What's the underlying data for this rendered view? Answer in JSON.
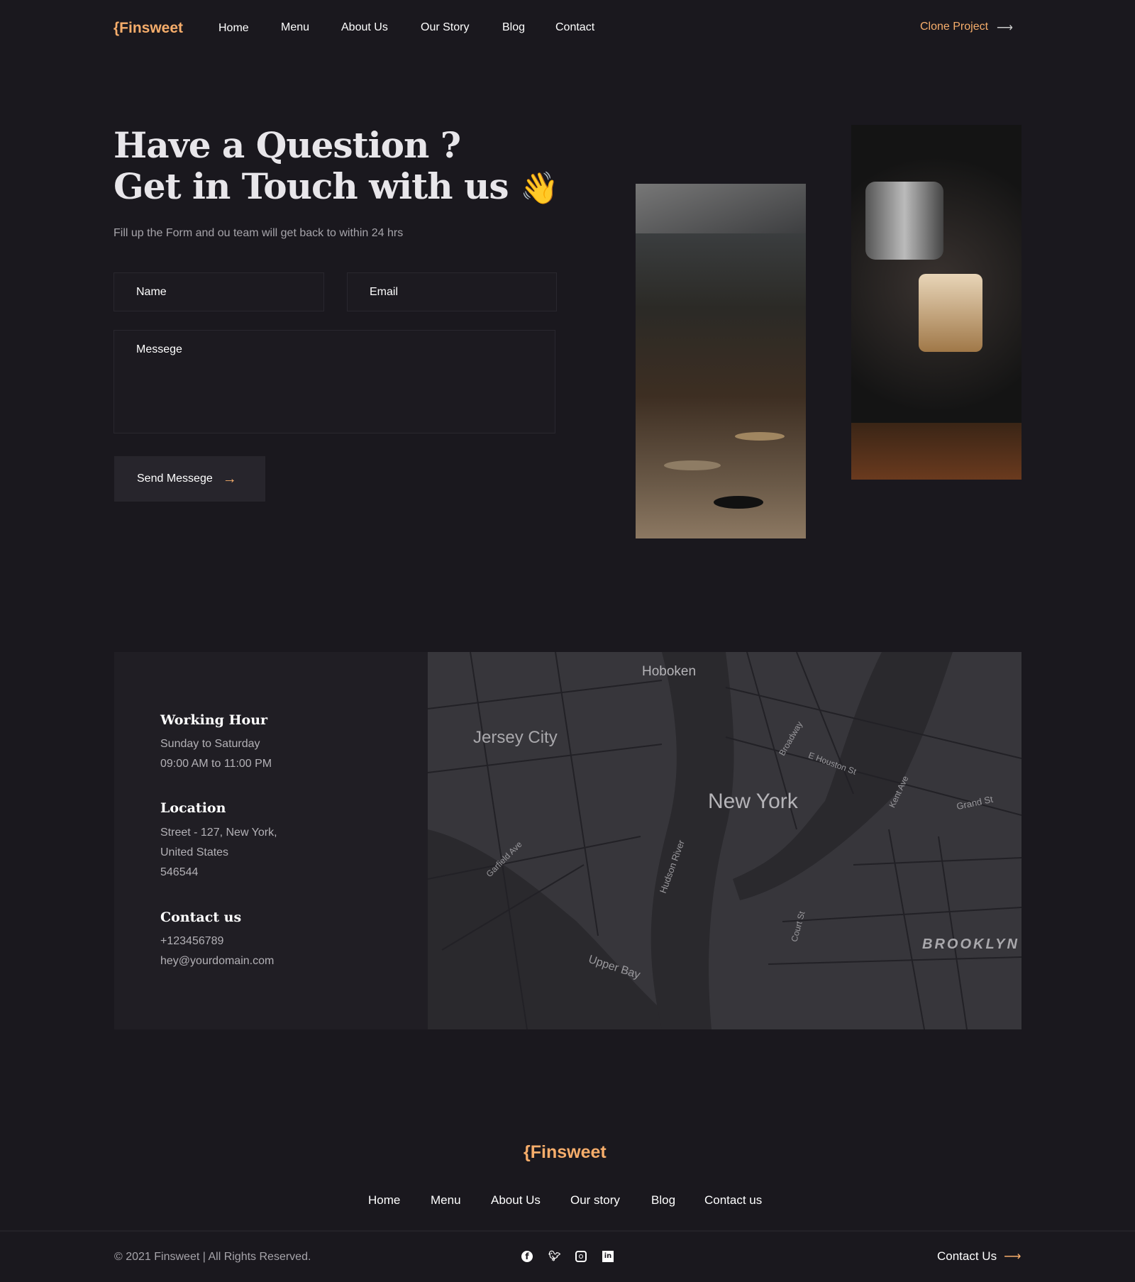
{
  "brand": "{Finsweet",
  "nav": {
    "items": [
      "Home",
      "Menu",
      "About Us",
      "Our Story",
      "Blog",
      "Contact"
    ],
    "cta": "Clone Project"
  },
  "hero": {
    "title_line1": "Have a Question ?",
    "title_line2": "Get in Touch with us",
    "emoji": "👋",
    "subtitle": "Fill up the Form  and ou team will get back to within 24 hrs"
  },
  "form": {
    "name_placeholder": "Name",
    "email_placeholder": "Email",
    "message_placeholder": "Messege",
    "submit": "Send Messege"
  },
  "info": {
    "working_title": "Working Hour",
    "working_days": "Sunday to Saturday",
    "working_time": "09:00 AM to 11:00 PM",
    "location_title": "Location",
    "address1": "Street - 127, New York,",
    "address2": "United States",
    "zip": "546544",
    "contact_title": "Contact us",
    "phone": "+123456789",
    "email": "hey@yourdomain.com"
  },
  "map": {
    "labels": {
      "hoboken": "Hoboken",
      "jersey": "Jersey City",
      "newyork": "New York",
      "brooklyn": "BROOKLYN",
      "upperbay": "Upper Bay",
      "hudson": "Hudson River",
      "grand": "Grand St",
      "garfield": "Garfield Ave",
      "houston": "E Houston St",
      "broadway": "Broadway",
      "kent": "Kent Ave",
      "court": "Court St"
    }
  },
  "footer": {
    "brand": "{Finsweet",
    "links": [
      "Home",
      "Menu",
      "About Us",
      "Our story",
      "Blog",
      "Contact us"
    ],
    "copyright": "© 2021 Finsweet | All Rights Reserved.",
    "cta": "Contact Us",
    "social": [
      "facebook-icon",
      "twitter-icon",
      "instagram-icon",
      "linkedin-icon"
    ]
  },
  "colors": {
    "accent": "#f6ad6b",
    "bg": "#1a181e"
  }
}
